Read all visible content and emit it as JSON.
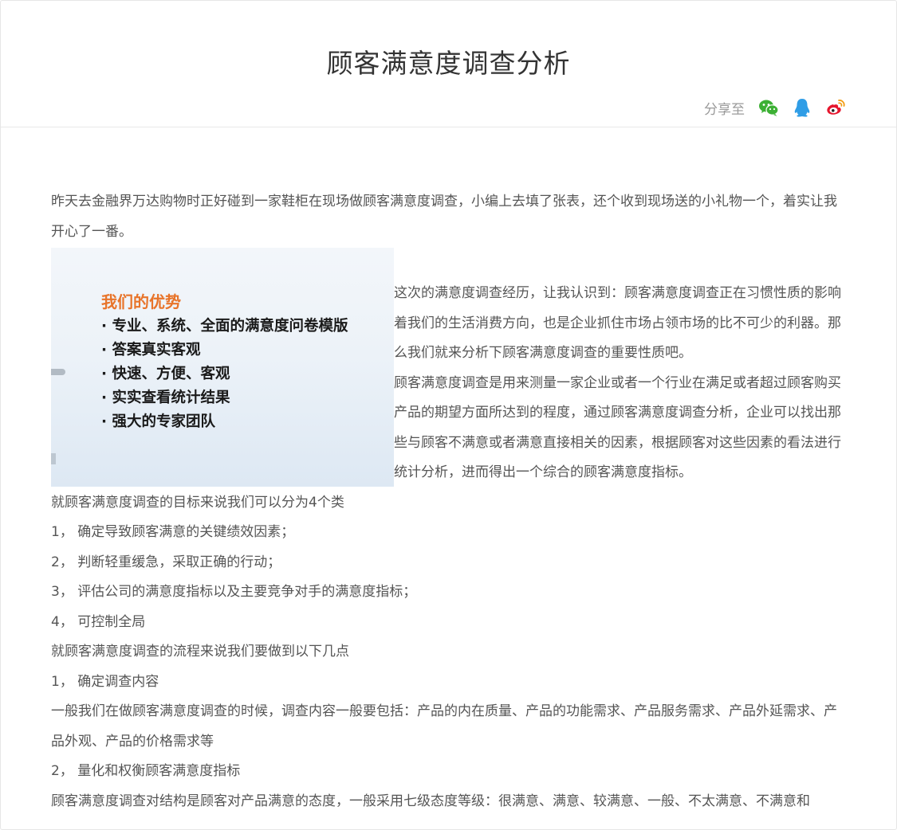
{
  "article": {
    "title": "顾客满意度调查分析",
    "share_label": "分享至",
    "share_icons": [
      "wechat-icon",
      "qq-icon",
      "weibo-icon"
    ]
  },
  "colors": {
    "wechat": "#3cb034",
    "qq": "#2f9de6",
    "weibo": "#e6162d",
    "promo_heading": "#e8742a"
  },
  "promo_image": {
    "heading": "我们的优势",
    "items": [
      "专业、系统、全面的满意度问卷模版",
      "答案真实客观",
      "快速、方便、客观",
      "实实查看统计结果",
      "强大的专家团队"
    ]
  },
  "content": {
    "intro": "昨天去金融界万达购物时正好碰到一家鞋柜在现场做顾客满意度调查，小编上去填了张表，还个收到现场送的小礼物一个，着实让我开心了一番。",
    "float_para1": "这次的满意度调查经历，让我认识到：顾客满意度调查正在习惯性质的影响着我们的生活消费方向，也是企业抓住市场占领市场的比不可少的利器。那么我们就来分析下顾客满意度调查的重要性质吧。",
    "float_para2": "顾客满意度调查是用来测量一家企业或者一个行业在满足或者超过顾客购买产品的期望方面所达到的程度，通过顾客满意度调查分析，企业可以找出那些与顾客不满意或者满意直接相关的因素，根据顾客对这些因素的看法进行统计分析，进而得出一个综合的顾客满意度指标。",
    "goals_intro": "就顾客满意度调查的目标来说我们可以分为4个类",
    "goals": [
      "1， 确定导致顾客满意的关键绩效因素；",
      "2， 判断轻重缓急，采取正确的行动；",
      "3， 评估公司的满意度指标以及主要竞争对手的满意度指标；",
      "4， 可控制全局"
    ],
    "process_intro": "就顾客满意度调查的流程来说我们要做到以下几点",
    "step1": "1， 确定调查内容",
    "step1_text": "一般我们在做顾客满意度调查的时候，调查内容一般要包括：产品的内在质量、产品的功能需求、产品服务需求、产品外延需求、产品外观、产品的价格需求等",
    "step2": "2， 量化和权衡顾客满意度指标",
    "step2_text": "顾客满意度调查对结构是顾客对产品满意的态度，一般采用七级态度等级：很满意、满意、较满意、一般、不太满意、不满意和"
  }
}
